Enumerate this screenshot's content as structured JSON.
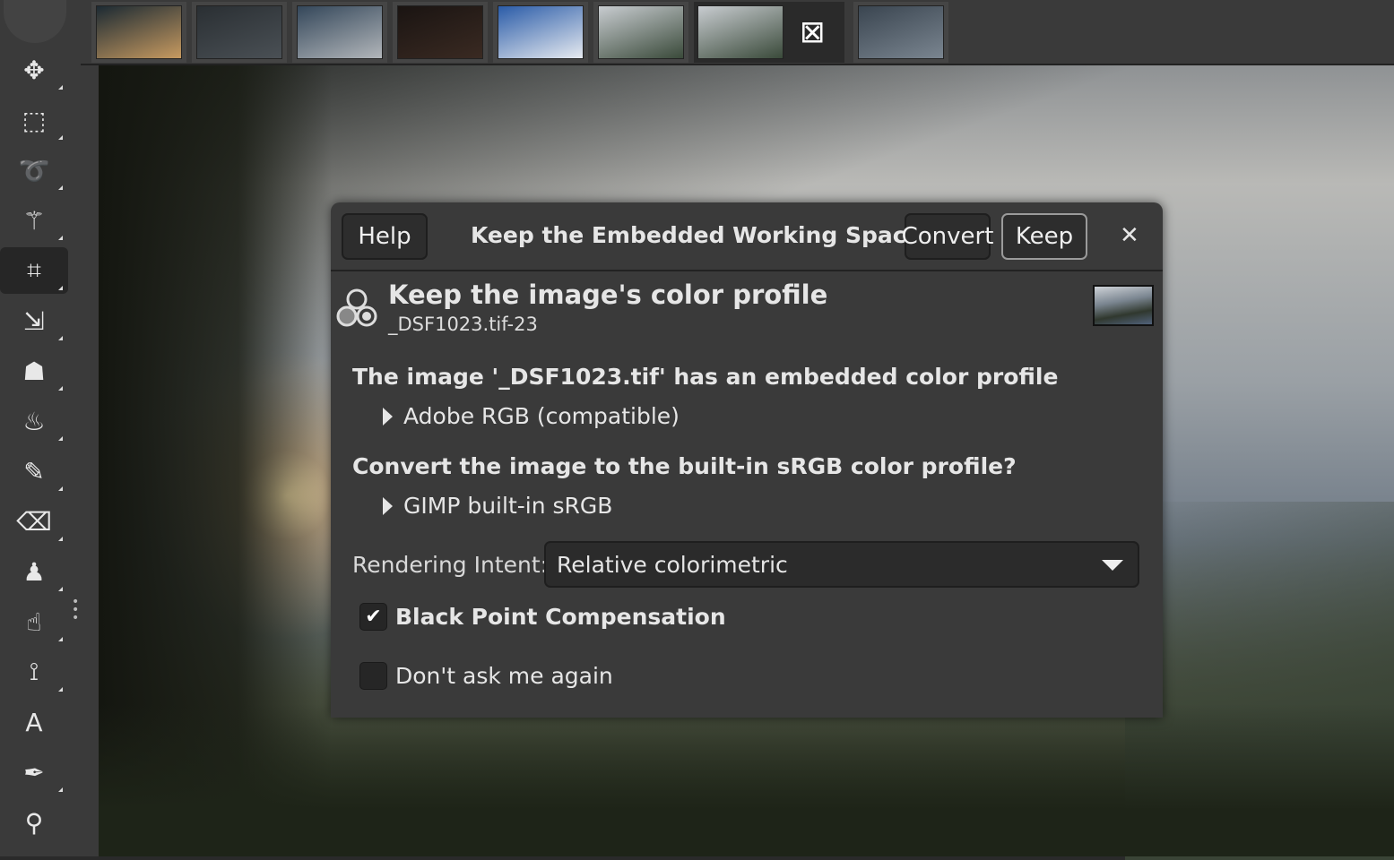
{
  "toolbox": {
    "tools": [
      {
        "name": "move",
        "glyph": "✥",
        "active": false
      },
      {
        "name": "rect-select",
        "glyph": "⬚",
        "active": false
      },
      {
        "name": "lasso",
        "glyph": "➰",
        "active": false
      },
      {
        "name": "fuzzy-select",
        "glyph": "⚚",
        "active": false
      },
      {
        "name": "crop",
        "glyph": "⌗",
        "active": true
      },
      {
        "name": "unified-transform",
        "glyph": "⇲",
        "active": false
      },
      {
        "name": "warp",
        "glyph": "☗",
        "active": false
      },
      {
        "name": "bucket-fill",
        "glyph": "♨",
        "active": false
      },
      {
        "name": "paintbrush",
        "glyph": "✎",
        "active": false
      },
      {
        "name": "eraser",
        "glyph": "⌫",
        "active": false
      },
      {
        "name": "clone",
        "glyph": "♟",
        "active": false
      },
      {
        "name": "smudge",
        "glyph": "☝",
        "active": false
      },
      {
        "name": "paths",
        "glyph": "⟟",
        "active": false
      },
      {
        "name": "text",
        "glyph": "A",
        "active": false
      },
      {
        "name": "color-picker",
        "glyph": "✒",
        "active": false
      },
      {
        "name": "zoom",
        "glyph": "⚲",
        "active": false
      }
    ]
  },
  "image_tabs": [
    {
      "colors": [
        "#1c2a33",
        "#c79a60"
      ]
    },
    {
      "colors": [
        "#2a2f33",
        "#4a5055"
      ]
    },
    {
      "colors": [
        "#34475a",
        "#b2b6ba"
      ]
    },
    {
      "colors": [
        "#1a1412",
        "#3a2a22"
      ]
    },
    {
      "colors": [
        "#2b5ca8",
        "#e6eaf0"
      ]
    },
    {
      "colors": [
        "#c8ccd0",
        "#3a4a3a"
      ]
    },
    {
      "colors": [
        "#c8ccd0",
        "#3a4a3a"
      ],
      "active": true,
      "close_icon": "close-box-icon"
    },
    {
      "colors": [
        "#3a4550",
        "#7a8590"
      ]
    }
  ],
  "dialog": {
    "help_label": "Help",
    "title": "Keep the Embedded Working Space?",
    "convert_label": "Convert",
    "keep_label": "Keep",
    "close_glyph": "✕",
    "heading": "Keep the image's color profile",
    "subheading": "_DSF1023.tif-23",
    "embedded_text": "The image '_DSF1023.tif' has an embedded color profile",
    "embedded_profile": "Adobe RGB (compatible)",
    "convert_text": "Convert the image to the built-in sRGB color profile?",
    "builtin_profile": "GIMP built-in sRGB",
    "intent_label": "Rendering Intent:",
    "intent_value": "Relative colorimetric",
    "bpc_label": "Black Point Compensation",
    "bpc_checked": true,
    "dont_ask_label": "Don't ask me again",
    "dont_ask_checked": false
  }
}
